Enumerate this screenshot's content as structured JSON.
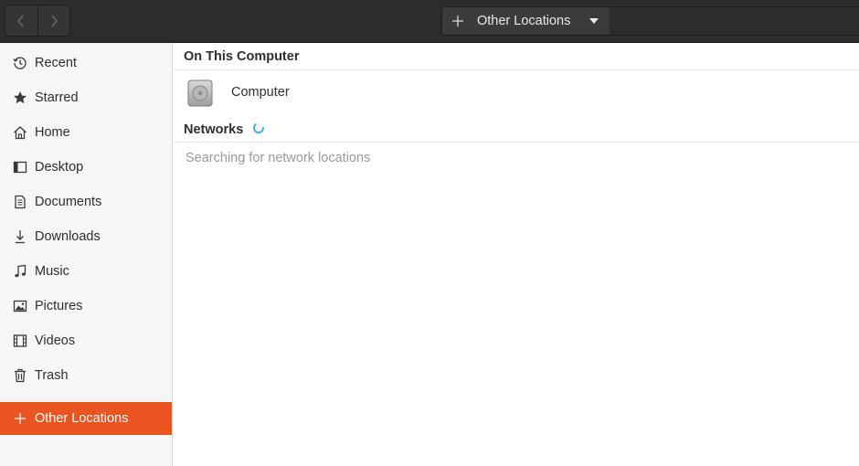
{
  "header": {
    "back_icon": "chevron-left-icon",
    "forward_icon": "chevron-right-icon",
    "path_plus_icon": "plus-icon",
    "location_label": "Other Locations",
    "menu_icon": "triangle-down-icon"
  },
  "sidebar": {
    "items": [
      {
        "label": "Recent",
        "icon": "clock-icon"
      },
      {
        "label": "Starred",
        "icon": "star-icon"
      },
      {
        "label": "Home",
        "icon": "home-icon"
      },
      {
        "label": "Desktop",
        "icon": "desktop-icon"
      },
      {
        "label": "Documents",
        "icon": "document-icon"
      },
      {
        "label": "Downloads",
        "icon": "download-icon"
      },
      {
        "label": "Music",
        "icon": "music-icon"
      },
      {
        "label": "Pictures",
        "icon": "picture-icon"
      },
      {
        "label": "Videos",
        "icon": "film-icon"
      },
      {
        "label": "Trash",
        "icon": "trash-icon"
      }
    ],
    "other_locations": {
      "label": "Other Locations",
      "icon": "plus-icon",
      "active": true
    }
  },
  "main": {
    "on_this_computer": {
      "title": "On This Computer",
      "items": [
        {
          "label": "Computer",
          "icon": "drive-icon"
        }
      ]
    },
    "networks": {
      "title": "Networks",
      "status_icon": "spinner-icon",
      "message": "Searching for network locations"
    }
  },
  "colors": {
    "accent": "#e95420",
    "headerbar": "#2c2c2c",
    "sidebar_bg": "#f6f6f6",
    "spinner": "#3daee9"
  }
}
